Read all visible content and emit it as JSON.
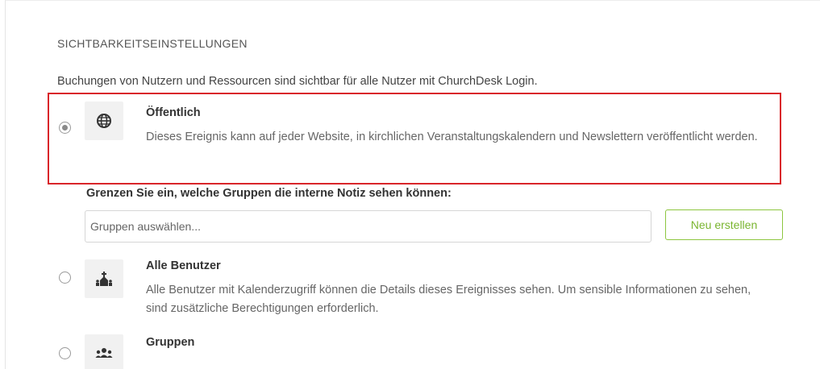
{
  "section": {
    "title": "SICHTBARKEITSEINSTELLUNGEN",
    "info": "Buchungen von Nutzern und Ressourcen sind sichtbar für alle Nutzer mit ChurchDesk Login."
  },
  "options": [
    {
      "title": "Öffentlich",
      "description": "Dieses Ereignis kann auf jeder Website, in kirchlichen Veranstaltungskalendern und Newslettern veröffentlicht werden.",
      "selected": true,
      "icon": "globe-icon"
    },
    {
      "title": "Alle Benutzer",
      "description": "Alle Benutzer mit Kalenderzugriff können die Details dieses Ereignisses sehen. Um sensible Informationen zu sehen, sind zusätzliche Berechtigungen erforderlich.",
      "selected": false,
      "icon": "church-people-icon"
    },
    {
      "title": "Gruppen",
      "description": "",
      "selected": false,
      "icon": "group-icon"
    }
  ],
  "groups": {
    "label": "Grenzen Sie ein, welche Gruppen die interne Notiz sehen können:",
    "placeholder": "Gruppen auswählen...",
    "new_button": "Neu erstellen"
  },
  "colors": {
    "highlight": "#d9252a",
    "accent_green": "#8dc63f"
  }
}
